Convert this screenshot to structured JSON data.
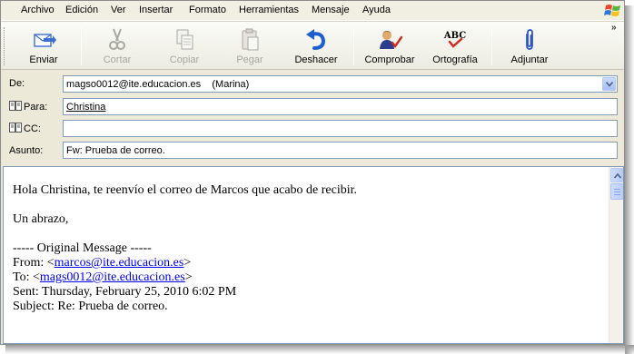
{
  "menu": [
    "Archivo",
    "Edición",
    "Ver",
    "Insertar",
    "Formato",
    "Herramientas",
    "Mensaje",
    "Ayuda"
  ],
  "toolbar": {
    "send": "Enviar",
    "cut": "Cortar",
    "copy": "Copiar",
    "paste": "Pegar",
    "undo": "Deshacer",
    "check": "Comprobar",
    "spelling": "Ortografía",
    "spelling_icon_text": "ABC",
    "attach": "Adjuntar",
    "more": "»"
  },
  "headers": {
    "from_label": "De:",
    "from_value": "magso0012@ite.educacion.es    (Marina)",
    "to_label": "Para:",
    "to_value": "Christina",
    "cc_label": "CC:",
    "cc_value": "",
    "subject_label": "Asunto:",
    "subject_value": "Fw: Prueba de correo."
  },
  "body": {
    "greeting": "Hola Christina, te reenvío el correo de Marcos que acabo de recibir.",
    "closing": "Un abrazo,",
    "original_header": "----- Original Message -----",
    "from_prefix": "From: <",
    "from_email": "marcos@ite.educacion.es",
    "from_suffix": ">",
    "to_prefix": "To: <",
    "to_email": "mags0012@ite.educacion.es",
    "to_suffix": ">",
    "sent": "Sent: Thursday, February 25, 2010 6:02 PM",
    "subject": "Subject: Re: Prueba de correo."
  },
  "colors": {
    "window_bg": "#ece9d8",
    "field_border": "#7f9db9",
    "link": "#0000ee",
    "send_icon": "#3b6fd1",
    "undo_icon": "#1d5fd0",
    "check_mark": "#d12a1a",
    "attach_icon": "#2f57c4"
  },
  "icons": [
    "send-icon",
    "scissors-icon",
    "copy-icon",
    "paste-icon",
    "undo-icon",
    "check-names-icon",
    "spelling-icon",
    "paperclip-icon",
    "address-book-icon",
    "windows-logo-icon"
  ]
}
